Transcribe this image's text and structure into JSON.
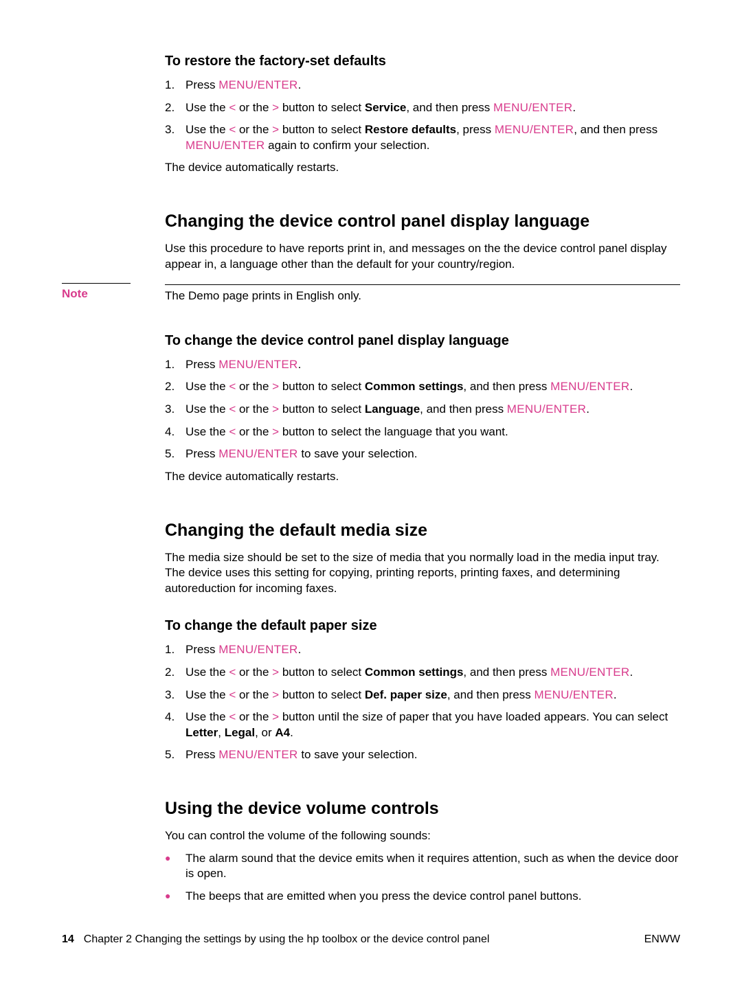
{
  "s1": {
    "title": "To restore the factory-set defaults",
    "li1_a": "Press ",
    "li1_b": "MENU/ENTER",
    "li1_c": ".",
    "li2_a": "Use the ",
    "li2_lt": "<",
    "li2_b": " or the ",
    "li2_gt": ">",
    "li2_c": " button to select ",
    "li2_bold": "Service",
    "li2_d": ", and then press ",
    "li2_me": "MENU/ENTER",
    "li2_e": ".",
    "li3_a": "Use the ",
    "li3_lt": "<",
    "li3_b": " or the ",
    "li3_gt": ">",
    "li3_c": " button to select ",
    "li3_bold": "Restore defaults",
    "li3_d": ", press ",
    "li3_me1": "MENU/ENTER",
    "li3_e": ", and then press ",
    "li3_me2": "MENU/ENTER",
    "li3_f": " again to confirm your selection.",
    "p1": "The device automatically restarts."
  },
  "s2": {
    "title": "Changing the device control panel display language",
    "p1": "Use this procedure to have reports print in, and messages on the the device control panel display appear in, a language other than the default for your country/region.",
    "note_label": "Note",
    "note_text": "The Demo page prints in English only."
  },
  "s3": {
    "title": "To change the device control panel display language",
    "li1_a": "Press ",
    "li1_b": "MENU/ENTER",
    "li1_c": ".",
    "li2_a": "Use the ",
    "li2_lt": "<",
    "li2_b": " or the ",
    "li2_gt": ">",
    "li2_c": " button to select ",
    "li2_bold": "Common settings",
    "li2_d": ", and then press ",
    "li2_me": "MENU/ENTER",
    "li2_e": ".",
    "li3_a": "Use the ",
    "li3_lt": "<",
    "li3_b": " or the ",
    "li3_gt": ">",
    "li3_c": " button to select ",
    "li3_bold": "Language",
    "li3_d": ", and then press ",
    "li3_me": "MENU/ENTER",
    "li3_e": ".",
    "li4_a": "Use the ",
    "li4_lt": "<",
    "li4_b": " or the ",
    "li4_gt": ">",
    "li4_c": " button to select the language that you want.",
    "li5_a": "Press ",
    "li5_me": "MENU/ENTER",
    "li5_b": " to save your selection.",
    "p1": "The device automatically restarts."
  },
  "s4": {
    "title": "Changing the default media size",
    "p1": "The media size should be set to the size of media that you normally load in the media input tray. The device uses this setting for copying, printing reports, printing faxes, and determining autoreduction for incoming faxes."
  },
  "s5": {
    "title": "To change the default paper size",
    "li1_a": "Press ",
    "li1_b": "MENU/ENTER",
    "li1_c": ".",
    "li2_a": "Use the ",
    "li2_lt": "<",
    "li2_b": " or the ",
    "li2_gt": ">",
    "li2_c": " button to select ",
    "li2_bold": "Common settings",
    "li2_d": ", and then press ",
    "li2_me": "MENU/ENTER",
    "li2_e": ".",
    "li3_a": "Use the ",
    "li3_lt": "<",
    "li3_b": " or the ",
    "li3_gt": ">",
    "li3_c": " button to select ",
    "li3_bold": "Def. paper size",
    "li3_d": ", and then press ",
    "li3_me": "MENU/ENTER",
    "li3_e": ".",
    "li4_a": "Use the ",
    "li4_lt": "<",
    "li4_b": " or the ",
    "li4_gt": ">",
    "li4_c": " button until the size of paper that you have loaded appears. You can select ",
    "li4_letter": "Letter",
    "li4_d": ", ",
    "li4_legal": "Legal",
    "li4_e": ", or ",
    "li4_a4": "A4",
    "li4_f": ".",
    "li5_a": "Press ",
    "li5_me": "MENU/ENTER",
    "li5_b": " to save your selection."
  },
  "s6": {
    "title": "Using the device volume controls",
    "p1": "You can control the volume of the following sounds:",
    "li1": "The alarm sound that the device emits when it requires attention, such as when the device door is open.",
    "li2": "The beeps that are emitted when you press the device control panel buttons."
  },
  "footer": {
    "page": "14",
    "chapter": "Chapter 2  Changing the settings by using the hp toolbox or the device control panel",
    "right": "ENWW"
  }
}
